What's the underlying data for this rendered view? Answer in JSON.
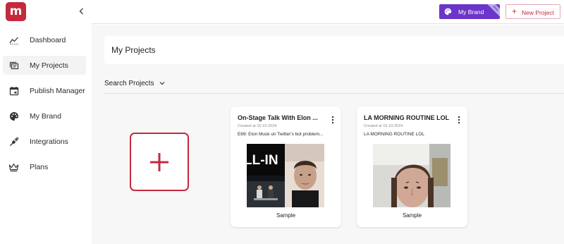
{
  "app": {
    "logo_letter": "m"
  },
  "sidebar": {
    "items": [
      {
        "label": "Dashboard",
        "icon": "trend-line-icon",
        "active": false
      },
      {
        "label": "My Projects",
        "icon": "projects-stack-icon",
        "active": true
      },
      {
        "label": "Publish Manager",
        "icon": "calendar-icon",
        "active": false
      },
      {
        "label": "My Brand",
        "icon": "palette-icon",
        "active": false
      },
      {
        "label": "Integrations",
        "icon": "plug-icon",
        "active": false
      },
      {
        "label": "Plans",
        "icon": "crown-icon",
        "active": false
      }
    ]
  },
  "topbar": {
    "brand_label": "My Brand",
    "brand_badge": "Beta",
    "new_project_label": "New Project"
  },
  "main": {
    "page_title": "My Projects",
    "search_label": "Search Projects"
  },
  "projects": [
    {
      "title": "On-Stage Talk With Elon ...",
      "created": "Created at 15-10-2024",
      "description": "E69: Elon Musk on Twitter's bot problem...",
      "thumb_text": "LL-IN",
      "label": "Sample"
    },
    {
      "title": "LA MORNING ROUTINE LOL",
      "created": "Created at 15-10-2024",
      "description": "LA MORNING ROUTINE LOL",
      "label": "Sample"
    }
  ],
  "colors": {
    "accent": "#c42a3e",
    "brand_purple": "#6a35c8",
    "background": "#f7f7f7"
  }
}
